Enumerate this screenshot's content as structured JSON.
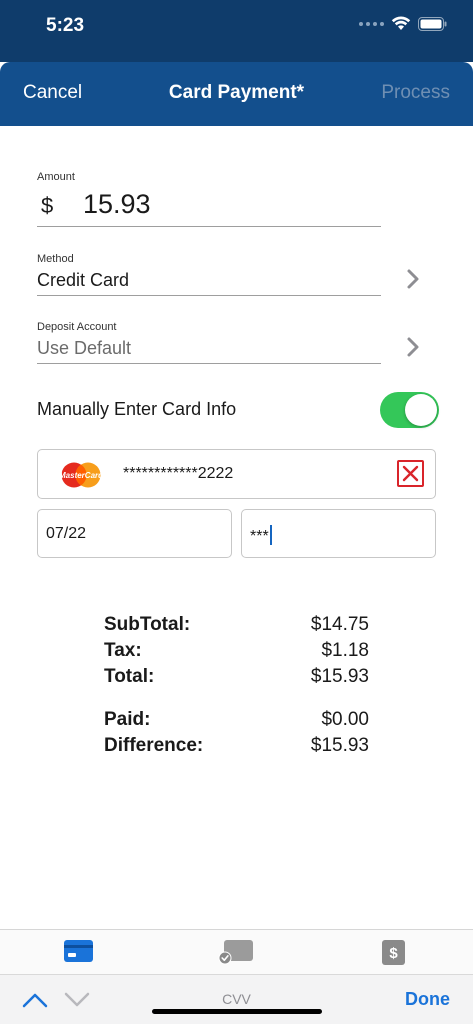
{
  "status": {
    "time": "5:23"
  },
  "nav": {
    "cancel_label": "Cancel",
    "title": "Card Payment*",
    "process_label": "Process"
  },
  "form": {
    "amount": {
      "label": "Amount",
      "currency": "$",
      "value": "15.93"
    },
    "method": {
      "label": "Method",
      "value": "Credit Card"
    },
    "deposit": {
      "label": "Deposit Account",
      "placeholder": "Use Default"
    },
    "manual_entry": {
      "label": "Manually Enter Card Info",
      "enabled": true
    }
  },
  "card": {
    "brand": "MasterCard",
    "number": "************2222",
    "expiry": "07/22",
    "cvv": "***"
  },
  "totals": {
    "subtotal": {
      "label": "SubTotal:",
      "value": "$14.75"
    },
    "tax": {
      "label": "Tax:",
      "value": "$1.18"
    },
    "total": {
      "label": "Total:",
      "value": "$15.93"
    },
    "paid": {
      "label": "Paid:",
      "value": "$0.00"
    },
    "difference": {
      "label": "Difference:",
      "value": "$15.93"
    }
  },
  "keyboard_bar": {
    "current_field": "CVV",
    "done_label": "Done"
  },
  "colors": {
    "nav_bg": "#134f8d",
    "toggle_on": "#34c759",
    "accent": "#1a73d9",
    "clear_red": "#d9242a"
  },
  "icons": [
    "wifi-icon",
    "battery-icon",
    "chevron-right-icon",
    "mastercard-logo",
    "clear-icon",
    "card-tab-icon",
    "check-tab-icon",
    "cash-tab-icon",
    "chevron-up-icon",
    "chevron-down-icon"
  ]
}
